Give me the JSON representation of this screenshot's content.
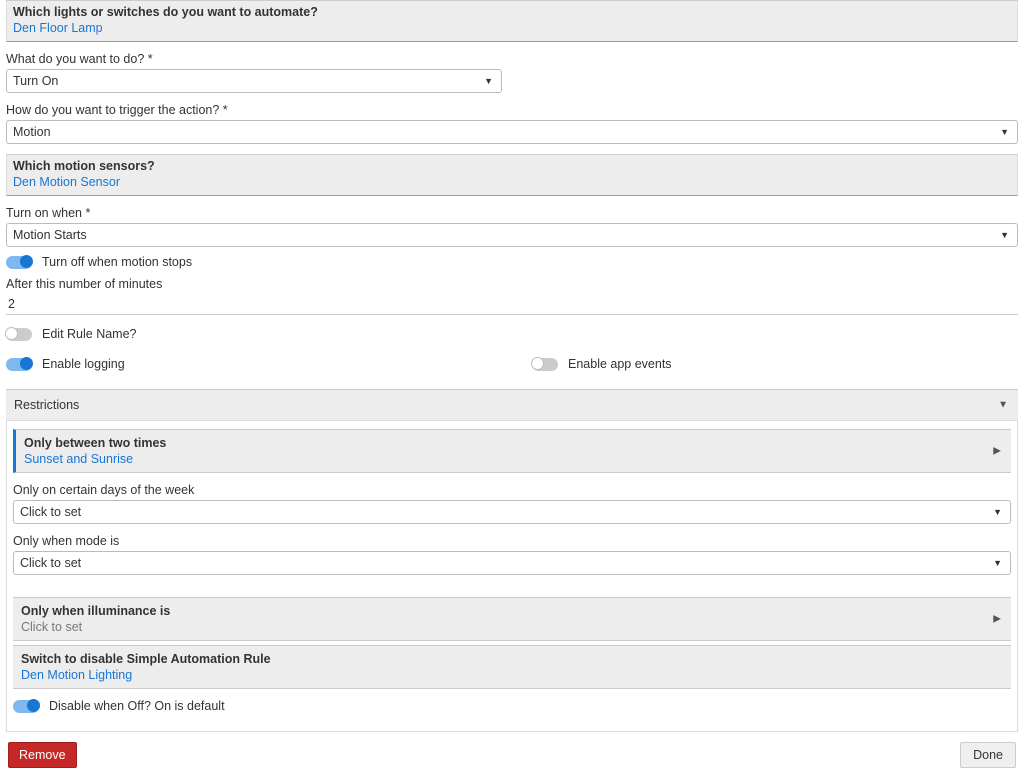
{
  "lights": {
    "question": "Which lights or switches do you want to automate?",
    "value": "Den Floor Lamp"
  },
  "action": {
    "label": "What do you want to do? *",
    "value": "Turn On"
  },
  "trigger": {
    "label": "How do you want to trigger the action? *",
    "value": "Motion"
  },
  "motion_sensors": {
    "question": "Which motion sensors?",
    "value": "Den Motion Sensor"
  },
  "turn_on_when": {
    "label": "Turn on when *",
    "value": "Motion Starts"
  },
  "turn_off_motion_stops": {
    "label": "Turn off when motion stops",
    "on": true
  },
  "after_minutes": {
    "label": "After this number of minutes",
    "value": "2"
  },
  "edit_rule_name": {
    "label": "Edit Rule Name?",
    "on": false
  },
  "enable_logging": {
    "label": "Enable logging",
    "on": true
  },
  "enable_app_events": {
    "label": "Enable app events",
    "on": false
  },
  "restrictions": {
    "header": "Restrictions",
    "between_times": {
      "title": "Only between two times",
      "value": "Sunset and Sunrise"
    },
    "days": {
      "label": "Only on certain days of the week",
      "value": "Click to set"
    },
    "mode": {
      "label": "Only when mode is",
      "value": "Click to set"
    },
    "illuminance": {
      "title": "Only when illuminance is",
      "value": "Click to set"
    },
    "disable_switch": {
      "title": "Switch to disable Simple Automation Rule",
      "value": "Den Motion Lighting"
    },
    "disable_when_off": {
      "label": "Disable when Off? On is default",
      "on": true
    }
  },
  "buttons": {
    "remove": "Remove",
    "done": "Done"
  }
}
